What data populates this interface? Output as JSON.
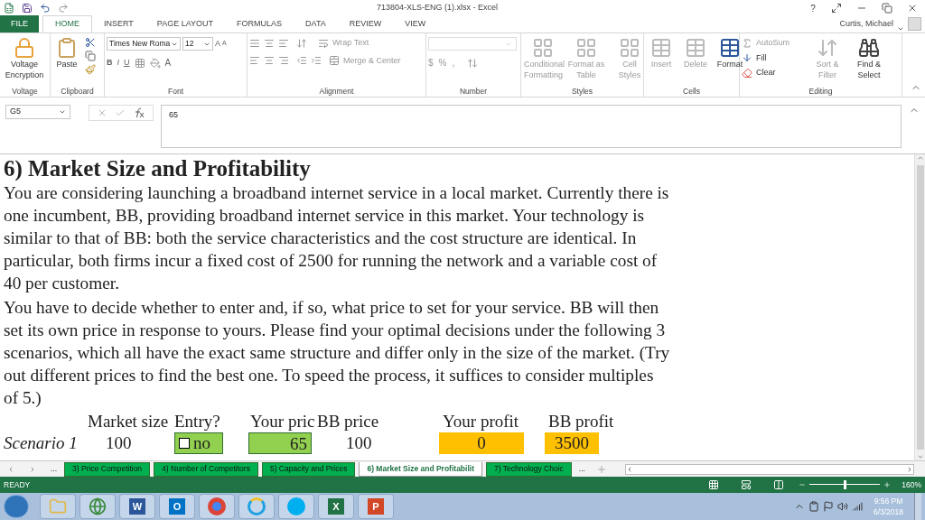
{
  "window": {
    "title": "713804-XLS-ENG (1).xlsx - Excel",
    "help": "?",
    "user": "Curtis, Michael"
  },
  "ribbon_tabs": [
    {
      "label": "FILE",
      "kind": "file",
      "selected": false
    },
    {
      "label": "HOME",
      "kind": "tab",
      "selected": true
    },
    {
      "label": "INSERT",
      "kind": "tab",
      "selected": false
    },
    {
      "label": "PAGE LAYOUT",
      "kind": "tab",
      "selected": false
    },
    {
      "label": "FORMULAS",
      "kind": "tab",
      "selected": false
    },
    {
      "label": "DATA",
      "kind": "tab",
      "selected": false
    },
    {
      "label": "REVIEW",
      "kind": "tab",
      "selected": false
    },
    {
      "label": "VIEW",
      "kind": "tab",
      "selected": false
    }
  ],
  "ribbon": {
    "voltage": {
      "button": "Voltage Encryption",
      "label": "Voltage"
    },
    "clipboard": {
      "paste": "Paste",
      "label": "Clipboard"
    },
    "font": {
      "name": "Times New Roma",
      "size": "12",
      "styles": [
        "B",
        "I",
        "U"
      ],
      "color_glyph": "A",
      "grow_glyph": "A",
      "shrink_glyph": "A",
      "label": "Font"
    },
    "alignment": {
      "wrap": "Wrap Text",
      "merge": "Merge & Center",
      "label": "Alignment"
    },
    "number": {
      "currency": "$",
      "percent": "%",
      "comma": ",",
      "label": "Number"
    },
    "styles": {
      "buttons": [
        {
          "label": "Conditional Formatting",
          "disabled": true
        },
        {
          "label": "Format as Table",
          "disabled": true
        },
        {
          "label": "Cell Styles",
          "disabled": true
        }
      ],
      "label": "Styles"
    },
    "cells": {
      "buttons": [
        {
          "label": "Insert",
          "disabled": true
        },
        {
          "label": "Delete",
          "disabled": true
        },
        {
          "label": "Format",
          "disabled": false
        }
      ],
      "label": "Cells"
    },
    "editing": {
      "autosum": "AutoSum",
      "fill": "Fill",
      "clear": "Clear",
      "buttons": [
        {
          "label": "Sort & Filter",
          "disabled": true
        },
        {
          "label": "Find & Select",
          "disabled": false
        }
      ],
      "label": "Editing"
    }
  },
  "formula_bar": {
    "name_box": "G5",
    "value": "65"
  },
  "sheet": {
    "heading": "6) Market Size and Profitability",
    "paragraphs": [
      "You are considering launching a broadband internet service in a local market. Currently there is one incumbent, BB, providing broadband internet service in this market. Your technology is similar to that of BB: both the service characteristics and the cost structure are identical. In particular, both firms incur a fixed cost of 2500 for running the network and a variable cost of 40 per customer.",
      "You have to decide whether to enter and, if so, what price to set for your service. BB will then set its own price in response to yours. Please find your optimal decisions under the following 3 scenarios, which all have the exact same  structure and differ only in the size of the market. (Try out different prices to find the best one. To speed the process, it suffices to consider multiples of 5.)"
    ],
    "columns": [
      "Market size",
      "Entry?",
      "Your pric",
      "BB price",
      "Your profit",
      "BB profit"
    ],
    "rows": [
      {
        "label": "Scenario 1",
        "market_size": "100",
        "entry": {
          "checked": false,
          "label": "no"
        },
        "your_price": "65",
        "bb_price": "100",
        "your_profit": "0",
        "bb_profit": "3500"
      }
    ]
  },
  "sheet_tabs": {
    "more": "...",
    "tabs": [
      {
        "label": "3) Price Competition",
        "selected": false
      },
      {
        "label": "4) Number of Competitors",
        "selected": false
      },
      {
        "label": "5) Capacity and Prices",
        "selected": false
      },
      {
        "label": "6) Market Size and Profitabilit",
        "selected": true
      },
      {
        "label": "7) Technology Choic",
        "selected": false
      }
    ],
    "more_after": "..."
  },
  "status_bar": {
    "status": "READY",
    "zoom": "160%",
    "zoom_level": {
      "level": 0.5
    }
  },
  "taskbar": {
    "apps": [
      {
        "kind": "folder"
      },
      {
        "kind": "globe"
      },
      {
        "kind": "letter",
        "glyph": "W",
        "color": "#2b579a"
      },
      {
        "kind": "letter",
        "glyph": "O",
        "color": "#0072c6"
      },
      {
        "kind": "chrome"
      },
      {
        "kind": "ie"
      },
      {
        "kind": "skype"
      },
      {
        "kind": "letter",
        "glyph": "X",
        "color": "#217346"
      },
      {
        "kind": "letter",
        "glyph": "P",
        "color": "#d24726"
      }
    ],
    "time": "9:56 PM",
    "date": "6/3/2018"
  }
}
